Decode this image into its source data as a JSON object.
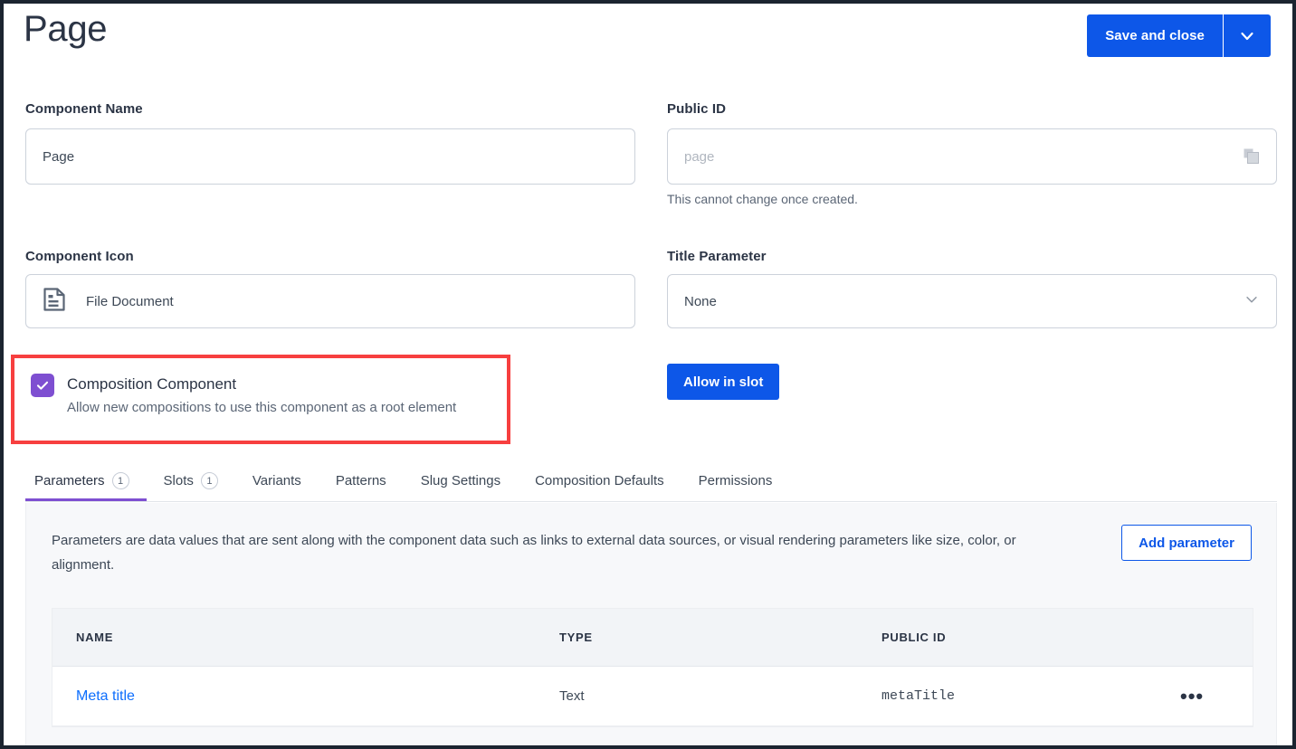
{
  "header": {
    "title": "Page",
    "save_label": "Save and close",
    "save_caret_icon": "chevron-down-icon"
  },
  "form": {
    "component_name": {
      "label": "Component Name",
      "value": "Page"
    },
    "public_id": {
      "label": "Public ID",
      "value": "",
      "placeholder": "page",
      "helper": "This cannot change once created.",
      "copy_icon": "copy-icon"
    },
    "component_icon": {
      "label": "Component Icon",
      "value": "File Document",
      "icon": "file-document-icon"
    },
    "title_parameter": {
      "label": "Title Parameter",
      "value": "None",
      "caret_icon": "chevron-down-icon"
    },
    "composition_component": {
      "label": "Composition Component",
      "description": "Allow new compositions to use this component as a root element",
      "checked": true,
      "check_icon": "check-icon",
      "highlight_color": "#f73f3f",
      "checkbox_color": "#7e4fd1"
    },
    "allow_in_slot": {
      "label": "Allow in slot"
    }
  },
  "tabs": [
    {
      "label": "Parameters",
      "badge": "1",
      "active": true
    },
    {
      "label": "Slots",
      "badge": "1",
      "active": false
    },
    {
      "label": "Variants",
      "badge": "",
      "active": false
    },
    {
      "label": "Patterns",
      "badge": "",
      "active": false
    },
    {
      "label": "Slug Settings",
      "badge": "",
      "active": false
    },
    {
      "label": "Composition Defaults",
      "badge": "",
      "active": false
    },
    {
      "label": "Permissions",
      "badge": "",
      "active": false
    }
  ],
  "panel": {
    "description": "Parameters are data values that are sent along with the component data such as links to external data sources, or visual rendering parameters like size, color, or alignment.",
    "add_button": "Add parameter",
    "table": {
      "columns": [
        "NAME",
        "TYPE",
        "PUBLIC ID"
      ],
      "rows": [
        {
          "name": "Meta title",
          "type": "Text",
          "public_id": "metaTitle",
          "actions_icon": "ellipsis-icon"
        }
      ]
    }
  },
  "colors": {
    "primary_blue": "#0d57e8",
    "link_blue": "#0d6efd",
    "purple": "#7e4fd1",
    "highlight_red": "#f73f3f"
  }
}
